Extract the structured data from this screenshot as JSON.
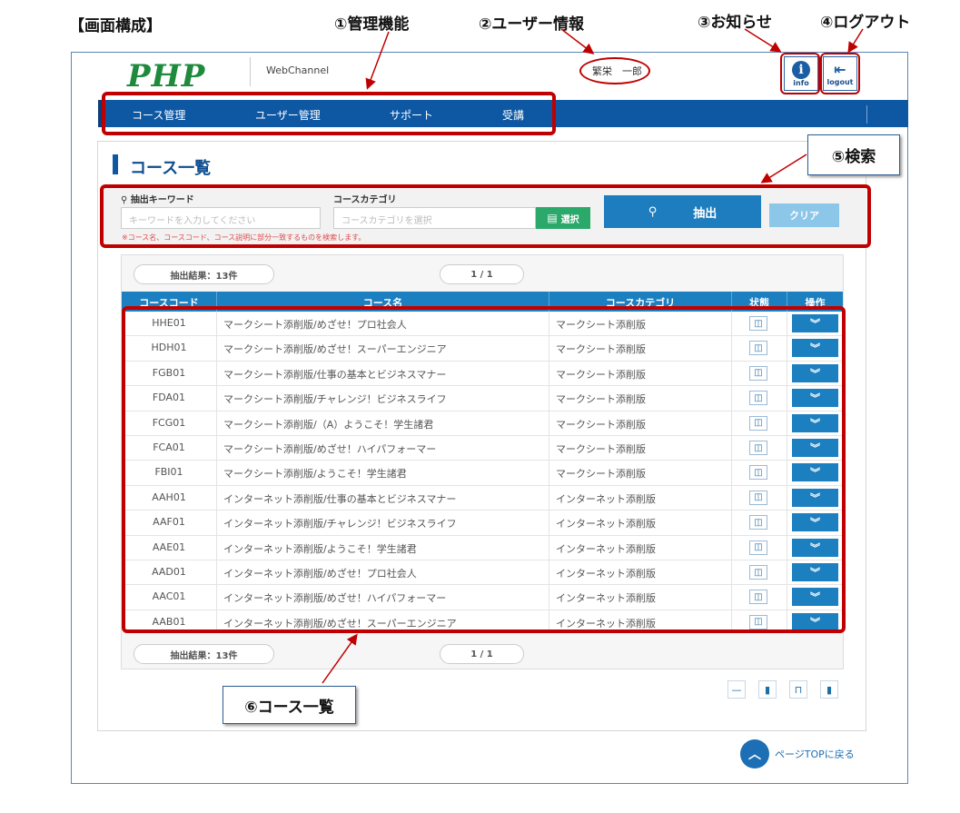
{
  "annotations": {
    "screen_title": "【画面構成】",
    "admin": "①管理機能",
    "user": "②ユーザー情報",
    "notice": "③お知らせ",
    "logout": "④ログアウト",
    "search": "⑤検索",
    "course_list": "⑥コース一覧"
  },
  "header": {
    "logo": "PHP",
    "app": "WebChannel",
    "user_name": "繁栄　一郎",
    "info_label": "info",
    "logout_label": "logout"
  },
  "nav": {
    "items": [
      "コース管理",
      "ユーザー管理",
      "サポート",
      "受講"
    ]
  },
  "page": {
    "title": "コース一覧"
  },
  "search": {
    "keyword_label": "抽出キーワード",
    "keyword_placeholder": "キーワードを入力してください",
    "category_label": "コースカテゴリ",
    "category_placeholder": "コースカテゴリを選択",
    "select_button": "選択",
    "extract_button": "抽出",
    "clear_button": "クリア",
    "note": "※コース名、コースコード、コース説明に部分一致するものを検索します。"
  },
  "results": {
    "count_label": "抽出結果：13件",
    "pager": "1 / 1",
    "columns": [
      "コースコード",
      "コース名",
      "コースカテゴリ",
      "状態",
      "操作"
    ],
    "rows": [
      {
        "code": "HHE01",
        "name": "マークシート添削版/めざせ！プロ社会人",
        "category": "マークシート添削版"
      },
      {
        "code": "HDH01",
        "name": "マークシート添削版/めざせ！スーパーエンジニア",
        "category": "マークシート添削版"
      },
      {
        "code": "FGB01",
        "name": "マークシート添削版/仕事の基本とビジネスマナー",
        "category": "マークシート添削版"
      },
      {
        "code": "FDA01",
        "name": "マークシート添削版/チャレンジ！ビジネスライフ",
        "category": "マークシート添削版"
      },
      {
        "code": "FCG01",
        "name": "マークシート添削版/（A）ようこそ！学生諸君",
        "category": "マークシート添削版"
      },
      {
        "code": "FCA01",
        "name": "マークシート添削版/めざせ！ハイパフォーマー",
        "category": "マークシート添削版"
      },
      {
        "code": "FBI01",
        "name": "マークシート添削版/ようこそ！学生諸君",
        "category": "マークシート添削版"
      },
      {
        "code": "AAH01",
        "name": "インターネット添削版/仕事の基本とビジネスマナー",
        "category": "インターネット添削版"
      },
      {
        "code": "AAF01",
        "name": "インターネット添削版/チャレンジ！ビジネスライフ",
        "category": "インターネット添削版"
      },
      {
        "code": "AAE01",
        "name": "インターネット添削版/ようこそ！学生諸君",
        "category": "インターネット添削版"
      },
      {
        "code": "AAD01",
        "name": "インターネット添削版/めざせ！プロ社会人",
        "category": "インターネット添削版"
      },
      {
        "code": "AAC01",
        "name": "インターネット添削版/めざせ！ハイパフォーマー",
        "category": "インターネット添削版"
      },
      {
        "code": "AAB01",
        "name": "インターネット添削版/めざせ！スーパーエンジニア",
        "category": "インターネット添削版"
      }
    ]
  },
  "footer": {
    "page_top": "ページTOPに戻る"
  }
}
